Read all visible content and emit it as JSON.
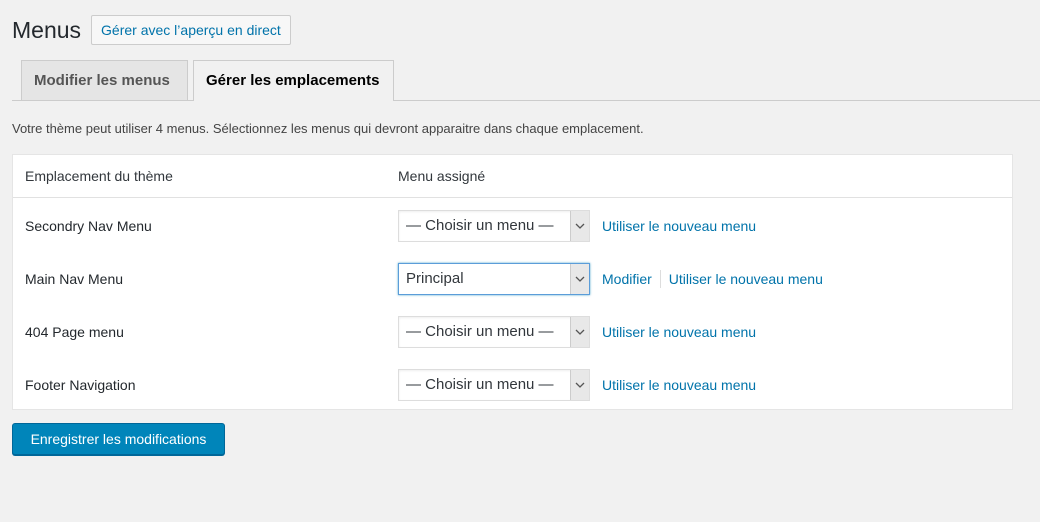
{
  "header": {
    "title": "Menus",
    "live_preview_label": "Gérer avec l’aperçu en direct"
  },
  "tabs": [
    {
      "label": "Modifier les menus",
      "active": false
    },
    {
      "label": "Gérer les emplacements",
      "active": true
    }
  ],
  "intro_text": "Votre thème peut utiliser 4 menus. Sélectionnez les menus qui devront apparaitre dans chaque emplacement.",
  "table": {
    "headers": [
      "Emplacement du thème",
      "Menu assigné"
    ],
    "rows": [
      {
        "location": "Secondry Nav Menu",
        "selected": "— Choisir un menu —",
        "edit_label": "",
        "new_menu_label": "Utiliser le nouveau menu"
      },
      {
        "location": "Main Nav Menu",
        "selected": "Principal",
        "edit_label": "Modifier",
        "new_menu_label": "Utiliser le nouveau menu"
      },
      {
        "location": "404 Page menu",
        "selected": "— Choisir un menu —",
        "edit_label": "",
        "new_menu_label": "Utiliser le nouveau menu"
      },
      {
        "location": "Footer Navigation",
        "selected": "— Choisir un menu —",
        "edit_label": "",
        "new_menu_label": "Utiliser le nouveau menu"
      }
    ]
  },
  "save_label": "Enregistrer les modifications",
  "colors": {
    "link": "#0073aa",
    "primary_button": "#0085ba",
    "background": "#f1f1f1"
  },
  "icons": {
    "select_arrow": "chevron-down-icon"
  }
}
